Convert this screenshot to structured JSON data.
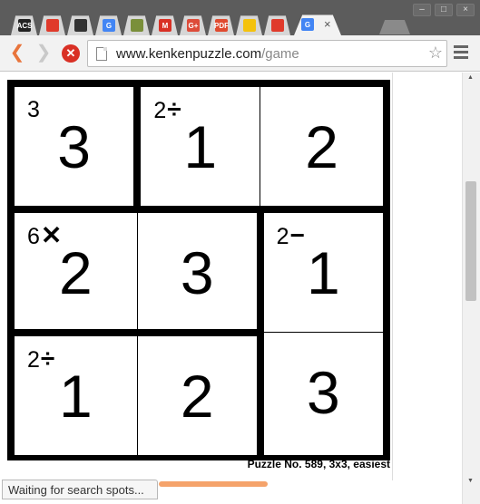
{
  "browser": {
    "tabs": [
      {
        "icon": "acs-favicon",
        "label": "ACS",
        "color": "#222222"
      },
      {
        "icon": "oracle-favicon",
        "label": "",
        "color": "#e03a2b"
      },
      {
        "icon": "github-favicon",
        "label": "",
        "color": "#333333"
      },
      {
        "icon": "google-favicon",
        "label": "G",
        "color": "#4285f4"
      },
      {
        "icon": "game-favicon",
        "label": "",
        "color": "#7a8f3a"
      },
      {
        "icon": "gmail-favicon",
        "label": "M",
        "color": "#d93025"
      },
      {
        "icon": "google-plus-favicon",
        "label": "G+",
        "color": "#dd4b39"
      },
      {
        "icon": "pdf-favicon",
        "label": "PDF",
        "color": "#e04a2f"
      },
      {
        "icon": "docs-favicon",
        "label": "",
        "color": "#f4c20d"
      },
      {
        "icon": "oracle-favicon",
        "label": "",
        "color": "#e03a2b"
      },
      {
        "icon": "google-favicon",
        "label": "G",
        "color": "#4285f4",
        "active": true
      }
    ],
    "active_tab_close": "×",
    "url_host": "www.kenkenpuzzle.com",
    "url_path": "/game",
    "status_text": "Waiting for search spots..."
  },
  "puzzle": {
    "size": 3,
    "grid": [
      [
        3,
        1,
        2
      ],
      [
        2,
        3,
        1
      ],
      [
        1,
        2,
        3
      ]
    ],
    "cages": [
      {
        "clue": "3",
        "op": "",
        "first_cell": [
          0,
          0
        ],
        "cells": [
          [
            0,
            0
          ]
        ]
      },
      {
        "clue": "2",
        "op": "÷",
        "first_cell": [
          0,
          1
        ],
        "cells": [
          [
            0,
            1
          ],
          [
            0,
            2
          ]
        ]
      },
      {
        "clue": "6",
        "op": "✕",
        "first_cell": [
          1,
          0
        ],
        "cells": [
          [
            1,
            0
          ],
          [
            1,
            1
          ]
        ]
      },
      {
        "clue": "2",
        "op": "−",
        "first_cell": [
          1,
          2
        ],
        "cells": [
          [
            1,
            2
          ],
          [
            2,
            2
          ]
        ]
      },
      {
        "clue": "2",
        "op": "÷",
        "first_cell": [
          2,
          0
        ],
        "cells": [
          [
            2,
            0
          ],
          [
            2,
            1
          ]
        ]
      }
    ],
    "footer": "Puzzle No. 589, 3x3, easiest"
  }
}
